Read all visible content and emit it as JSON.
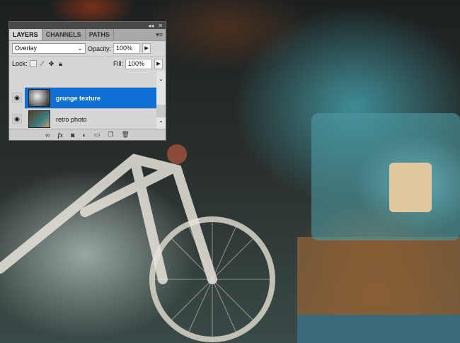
{
  "panel": {
    "tabs": [
      "LAYERS",
      "CHANNELS",
      "PATHS"
    ],
    "blend_mode": "Overlay",
    "opacity_label": "Opacity:",
    "opacity": "100%",
    "lock_label": "Lock:",
    "fill_label": "Fill:",
    "fill": "100%",
    "layers": [
      {
        "name": "grunge texture",
        "selected": true,
        "visible": true
      },
      {
        "name": "retro photo",
        "selected": false,
        "visible": true
      }
    ],
    "bottom_icons": [
      "link-icon",
      "fx-icon",
      "mask-icon",
      "adjustment-icon",
      "folder-icon",
      "new-layer-icon",
      "trash-icon"
    ],
    "fx_label": "fx"
  },
  "colors": {
    "selection": "#0f6fd5",
    "panel": "#d6d6d6"
  }
}
